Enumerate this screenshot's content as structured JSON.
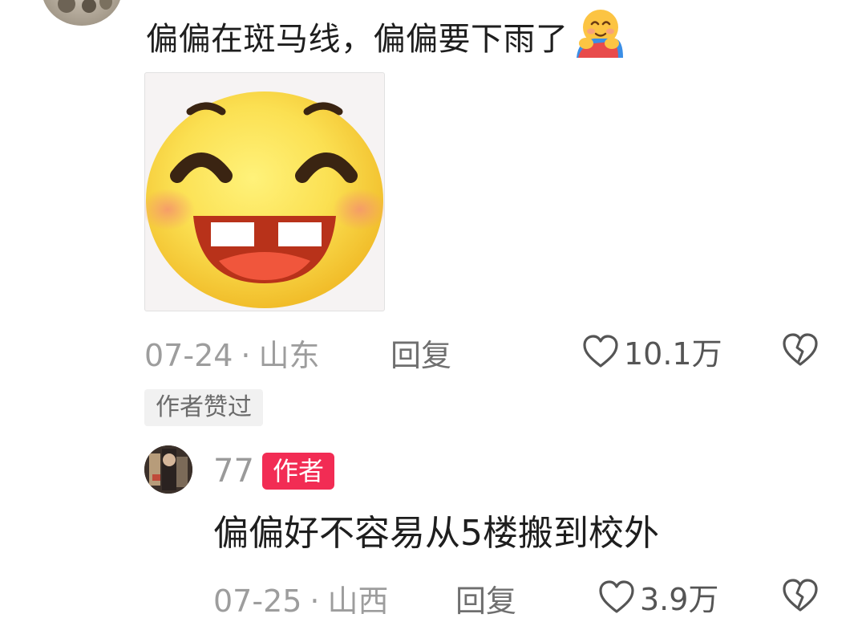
{
  "comment_1": {
    "text": "偏偏在斑马线，偏偏要下雨了",
    "emoji": "hugging-face-emoji",
    "sticker": "grinning-emoji-sticker",
    "date": "07-24",
    "separator": "·",
    "location": "山东",
    "reply_label": "回复",
    "likes": "10.1万",
    "author_liked_badge": "作者赞过"
  },
  "comment_2": {
    "username": "77",
    "author_badge": "作者",
    "text": "偏偏好不容易从5楼搬到校外",
    "date": "07-25",
    "separator": "·",
    "location": "山西",
    "reply_label": "回复",
    "likes": "3.9万"
  },
  "icons": {
    "like": "heart-outline-icon",
    "dislike": "broken-heart-icon"
  },
  "colors": {
    "author_badge_bg": "#f22c54",
    "meta_gray": "#9d9d9d",
    "text": "#1e1e1e"
  }
}
